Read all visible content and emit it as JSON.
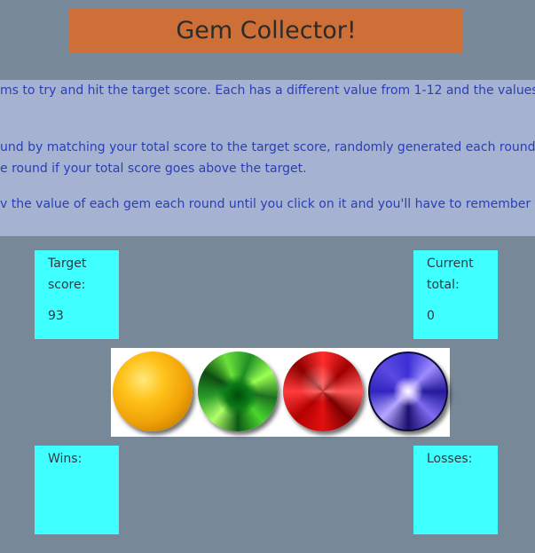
{
  "title": "Gem Collector!",
  "instructions": [
    "ms to try and hit the target score. Each has a different value from 1-12 and the values",
    "und by matching your total score to the target score, randomly generated each round",
    "e round if your total score goes above the target.",
    "v the value of each gem each round until you click on it and you'll have to remember t"
  ],
  "target": {
    "label": "Target\nscore:",
    "value": "93"
  },
  "current": {
    "label": "Current\ntotal:",
    "value": "0"
  },
  "wins": {
    "label": "Wins:",
    "value": ""
  },
  "losses": {
    "label": "Losses:",
    "value": ""
  },
  "gems": [
    {
      "name": "gold",
      "color": "#ffc21a"
    },
    {
      "name": "green",
      "color": "#2a9c2b"
    },
    {
      "name": "red",
      "color": "#e01010"
    },
    {
      "name": "blue",
      "color": "#3b2fd6"
    }
  ]
}
